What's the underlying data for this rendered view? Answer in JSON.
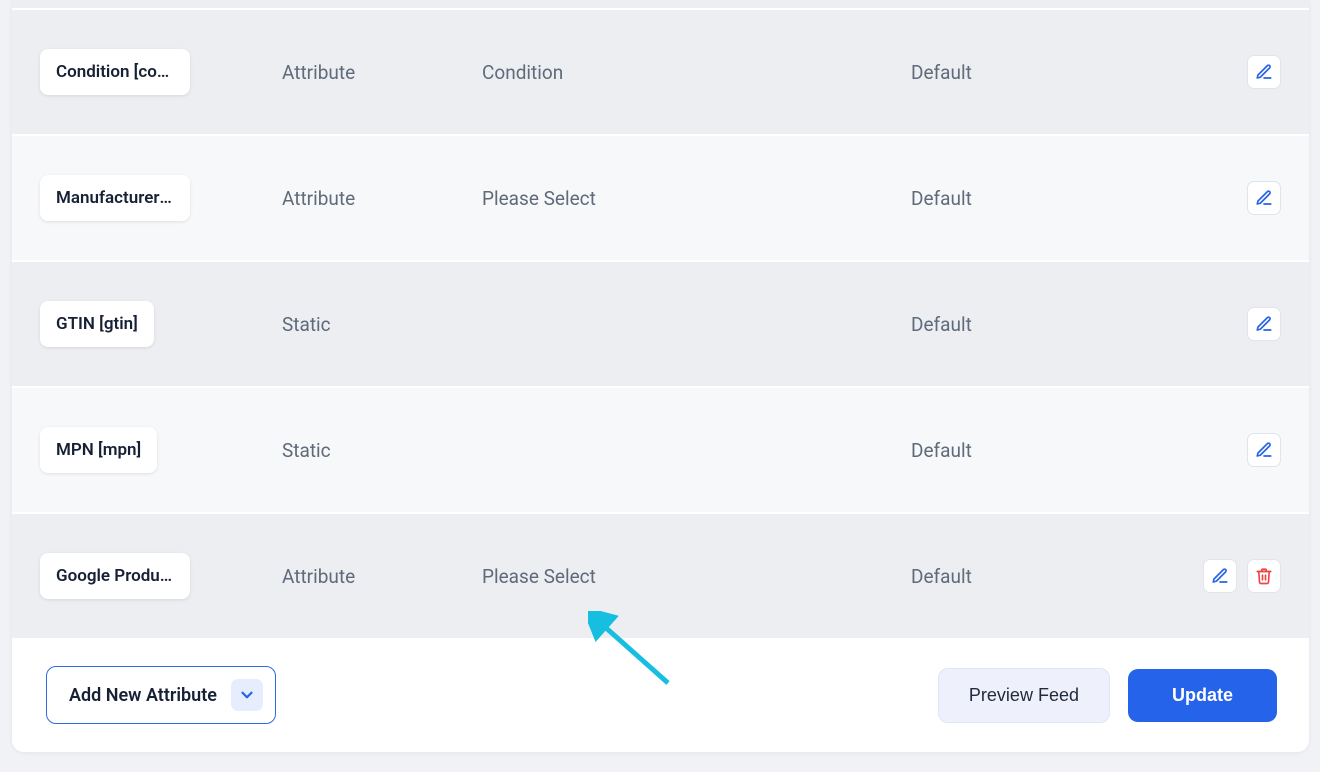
{
  "rows": [
    {
      "label": "Condition [condition]",
      "source": "Attribute",
      "mapping": "Condition",
      "output": "Default",
      "deletable": false
    },
    {
      "label": "Manufacturer Name",
      "source": "Attribute",
      "mapping": "Please Select",
      "output": "Default",
      "deletable": false
    },
    {
      "label": "GTIN [gtin]",
      "source": "Static",
      "mapping": "",
      "output": "Default",
      "deletable": false
    },
    {
      "label": "MPN [mpn]",
      "source": "Static",
      "mapping": "",
      "output": "Default",
      "deletable": false
    },
    {
      "label": "Google Product Category",
      "source": "Attribute",
      "mapping": "Please Select",
      "output": "Default",
      "deletable": true
    }
  ],
  "footer": {
    "add_label": "Add New Attribute",
    "preview_label": "Preview Feed",
    "update_label": "Update"
  },
  "colors": {
    "primary": "#2563eb",
    "danger": "#ef4444"
  }
}
